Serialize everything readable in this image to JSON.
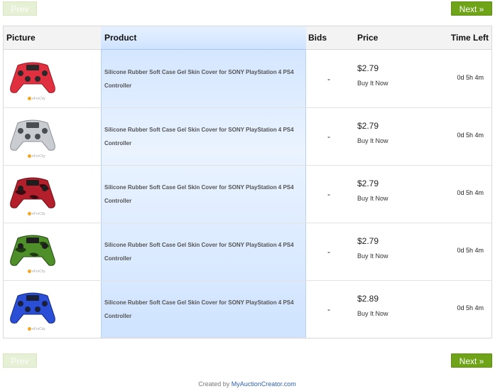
{
  "pager": {
    "prev_label": "Prev",
    "next_label": "Next »"
  },
  "columns": {
    "picture": "Picture",
    "product": "Product",
    "bids": "Bids",
    "price": "Price",
    "time_left": "Time Left"
  },
  "brand_label": "eForCity",
  "listings": [
    {
      "controller_color": "red",
      "title": "Silicone Rubber Soft Case Gel Skin Cover for SONY PlayStation 4 PS4 Controller",
      "bids": "-",
      "price": "$2.79",
      "buy_label": "Buy It Now",
      "time_left": "0d 5h 4m"
    },
    {
      "controller_color": "gray",
      "title": "Silicone Rubber Soft Case Gel Skin Cover for SONY PlayStation 4 PS4 Controller",
      "bids": "-",
      "price": "$2.79",
      "buy_label": "Buy It Now",
      "time_left": "0d 5h 4m"
    },
    {
      "controller_color": "red-camo",
      "title": "Silicone Rubber Soft Case Gel Skin Cover for SONY PlayStation 4 PS4 Controller",
      "bids": "-",
      "price": "$2.79",
      "buy_label": "Buy It Now",
      "time_left": "0d 5h 4m"
    },
    {
      "controller_color": "green-camo",
      "title": "Silicone Rubber Soft Case Gel Skin Cover for SONY PlayStation 4 PS4 Controller",
      "bids": "-",
      "price": "$2.79",
      "buy_label": "Buy It Now",
      "time_left": "0d 5h 4m"
    },
    {
      "controller_color": "blue",
      "title": "Silicone Rubber Soft Case Gel Skin Cover for SONY PlayStation 4 PS4 Controller",
      "bids": "-",
      "price": "$2.89",
      "buy_label": "Buy It Now",
      "time_left": "0d 5h 4m"
    }
  ],
  "footer": {
    "prefix": "Created by",
    "link": "MyAuctionCreator.com"
  },
  "colors": {
    "next_button": "#6fa318",
    "prev_button": "#e6f0d5",
    "product_column": "#cfe3ff",
    "link": "#2d63b2"
  }
}
